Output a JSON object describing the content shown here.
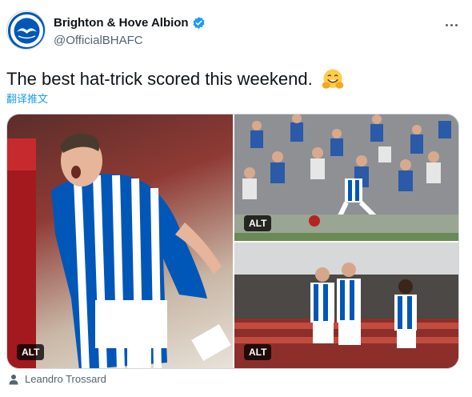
{
  "account": {
    "display_name": "Brighton & Hove Albion",
    "handle": "@OfficialBHAFC",
    "verified": true,
    "avatar_logo": "seagull-crest",
    "avatar_text": "ALBION"
  },
  "menu": {
    "more_icon": "more-horizontal-icon"
  },
  "tweet": {
    "text": "The best hat-trick scored this weekend.",
    "emoji": "smiling-face-with-open-hands",
    "translate_label": "翻译推文"
  },
  "media": {
    "photos": [
      {
        "alt_label": "ALT",
        "depicts": "player-celebrating"
      },
      {
        "alt_label": "ALT",
        "depicts": "crowd-celebration"
      },
      {
        "alt_label": "ALT",
        "depicts": "team-celebration"
      }
    ]
  },
  "tagged": {
    "icon": "person-icon",
    "name": "Leandro Trossard"
  },
  "colors": {
    "accent": "#1d9bf0",
    "text_primary": "#0f1419",
    "text_secondary": "#536471",
    "brighton_blue": "#0057b8"
  }
}
